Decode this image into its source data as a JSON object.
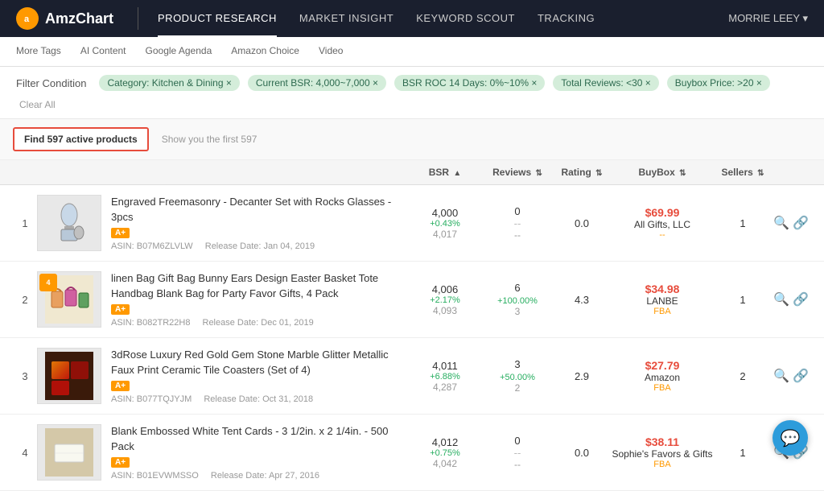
{
  "header": {
    "logo_text": "AmzChart",
    "logo_symbol": "a",
    "nav_items": [
      {
        "id": "product-research",
        "label": "PRODUCT RESEARCH",
        "active": true
      },
      {
        "id": "market-insight",
        "label": "MARKET INSIGHT",
        "active": false
      },
      {
        "id": "keyword-scout",
        "label": "KEYWORD SCOUT",
        "active": false
      },
      {
        "id": "tracking",
        "label": "TRACKING",
        "active": false
      }
    ],
    "user": "MORRIE LEEY ▾"
  },
  "sub_tabs": [
    {
      "id": "more-tags",
      "label": "More Tags"
    },
    {
      "id": "ai-content",
      "label": "AI Content"
    },
    {
      "id": "google-agenda",
      "label": "Google Agenda"
    },
    {
      "id": "amazon-choice",
      "label": "Amazon Choice"
    },
    {
      "id": "video",
      "label": "Video"
    }
  ],
  "filter_condition": {
    "label": "Filter Condition",
    "tags": [
      {
        "id": "category",
        "text": "Category: Kitchen & Dining ×"
      },
      {
        "id": "bsr",
        "text": "Current BSR: 4,000~7,000 ×"
      },
      {
        "id": "bsr-roc",
        "text": "BSR ROC 14 Days: 0%~10% ×"
      },
      {
        "id": "reviews",
        "text": "Total Reviews: <30 ×"
      },
      {
        "id": "buybox",
        "text": "Buybox Price: >20 ×"
      }
    ],
    "clear_all": "Clear All"
  },
  "table": {
    "find_button_label": "Find 597 active products",
    "show_text": "Show you the first 597",
    "columns": [
      {
        "id": "bsr",
        "label": "BSR",
        "sort": "▲"
      },
      {
        "id": "reviews",
        "label": "Reviews",
        "sort": "⇅"
      },
      {
        "id": "rating",
        "label": "Rating",
        "sort": "⇅"
      },
      {
        "id": "buybox",
        "label": "BuyBox",
        "sort": "⇅"
      },
      {
        "id": "sellers",
        "label": "Sellers",
        "sort": "⇅"
      }
    ],
    "rows": [
      {
        "rank": 1,
        "title": "Engraved Freemasonry - Decanter Set with Rocks Glasses - 3pcs",
        "has_aplus": true,
        "aplus_label": "A+",
        "asin": "B07M6ZLVLW",
        "release_date": "Jan 04, 2019",
        "bsr_main": "4,000",
        "bsr_change": "+0.43%",
        "bsr_change_type": "pos",
        "bsr_prev": "4,017",
        "reviews_main": "0",
        "reviews_change": "--",
        "reviews_change_type": "dash",
        "reviews_prev": "--",
        "rating": "0.0",
        "price": "$69.99",
        "seller": "All Gifts, LLC",
        "seller_fba": "--",
        "sellers_count": "1",
        "has_rank_badge": false
      },
      {
        "rank": 2,
        "title": "linen Bag Gift Bag Bunny Ears Design Easter Basket Tote Handbag Blank Bag for Party Favor Gifts, 4 Pack",
        "has_aplus": true,
        "aplus_label": "A+",
        "asin": "B082TR22H8",
        "release_date": "Dec 01, 2019",
        "bsr_main": "4,006",
        "bsr_change": "+2.17%",
        "bsr_change_type": "pos",
        "bsr_prev": "4,093",
        "reviews_main": "6",
        "reviews_change": "+100.00%",
        "reviews_change_type": "pos",
        "reviews_prev": "3",
        "rating": "4.3",
        "price": "$34.98",
        "seller": "LANBE",
        "seller_fba": "FBA",
        "sellers_count": "1",
        "has_rank_badge": true
      },
      {
        "rank": 3,
        "title": "3dRose Luxury Red Gold Gem Stone Marble Glitter Metallic Faux Print Ceramic Tile Coasters (Set of 4)",
        "has_aplus": true,
        "aplus_label": "A+",
        "asin": "B077TQJYJM",
        "release_date": "Oct 31, 2018",
        "bsr_main": "4,011",
        "bsr_change": "+6.88%",
        "bsr_change_type": "pos",
        "bsr_prev": "4,287",
        "reviews_main": "3",
        "reviews_change": "+50.00%",
        "reviews_change_type": "pos",
        "reviews_prev": "2",
        "rating": "2.9",
        "price": "$27.79",
        "seller": "Amazon",
        "seller_fba": "FBA",
        "sellers_count": "2",
        "has_rank_badge": false
      },
      {
        "rank": 4,
        "title": "Blank Embossed White Tent Cards - 3 1/2in. x 2 1/4in. - 500 Pack",
        "has_aplus": true,
        "aplus_label": "A+",
        "asin": "B01EVWMSSO",
        "release_date": "Apr 27, 2016",
        "bsr_main": "4,012",
        "bsr_change": "+0.75%",
        "bsr_change_type": "pos",
        "bsr_prev": "4,042",
        "reviews_main": "0",
        "reviews_change": "--",
        "reviews_change_type": "dash",
        "reviews_prev": "--",
        "rating": "0.0",
        "price": "$38.11",
        "seller": "Sophie's Favors & Gifts",
        "seller_fba": "FBA",
        "sellers_count": "1",
        "has_rank_badge": false
      }
    ]
  },
  "chat_icon": "💬",
  "colors": {
    "positive": "#27ae60",
    "negative": "#e74c3c",
    "orange": "#f90",
    "blue": "#2d9cdb"
  }
}
